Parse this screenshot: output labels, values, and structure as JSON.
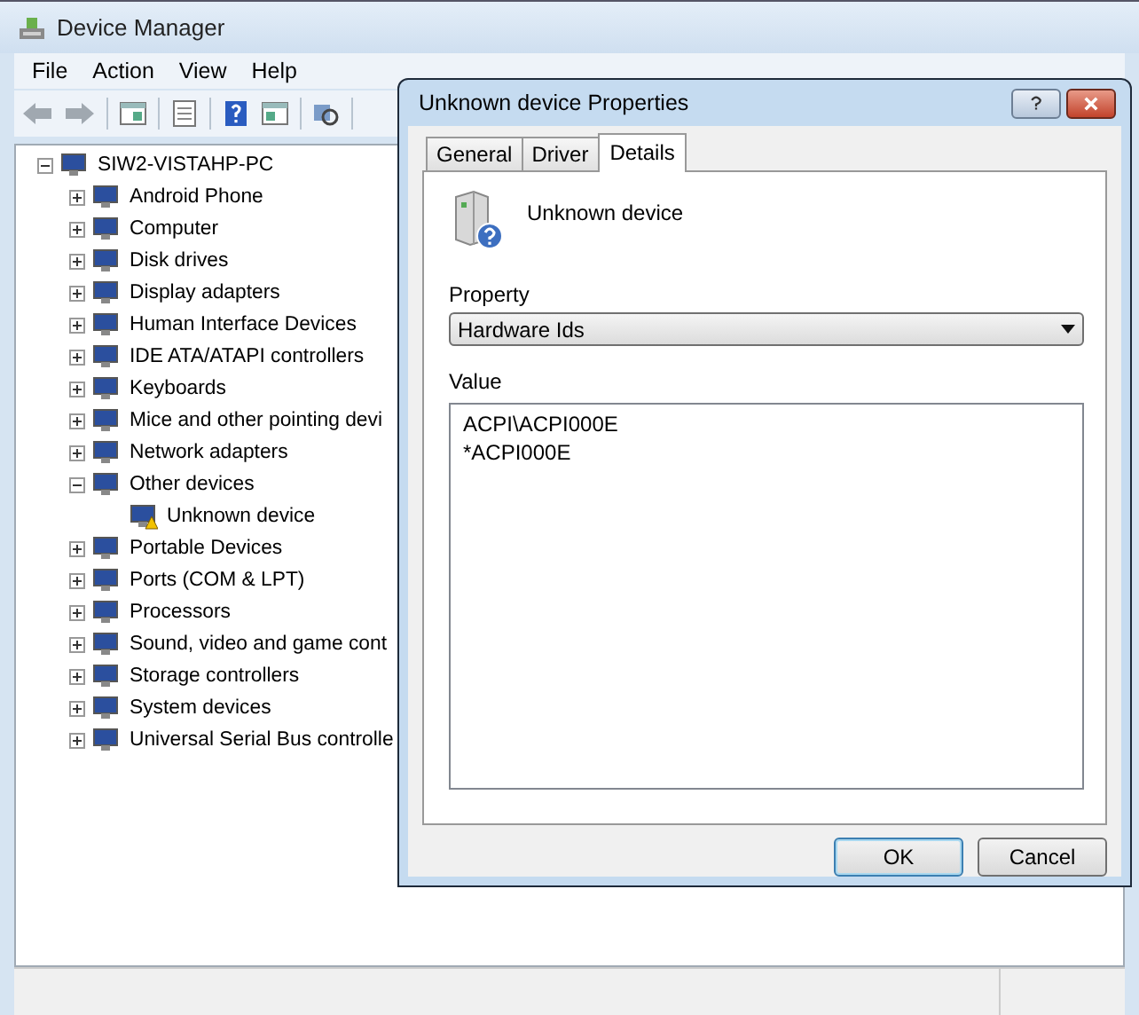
{
  "window": {
    "title": "Device Manager"
  },
  "menu": [
    "File",
    "Action",
    "View",
    "Help"
  ],
  "tree": {
    "label": "SIW2-VISTAHP-PC",
    "expanded": true,
    "children": [
      {
        "label": "Android Phone",
        "expanded": false
      },
      {
        "label": "Computer",
        "expanded": false
      },
      {
        "label": "Disk drives",
        "expanded": false
      },
      {
        "label": "Display adapters",
        "expanded": false
      },
      {
        "label": "Human Interface Devices",
        "expanded": false
      },
      {
        "label": "IDE ATA/ATAPI controllers",
        "expanded": false
      },
      {
        "label": "Keyboards",
        "expanded": false
      },
      {
        "label": "Mice and other pointing devi",
        "expanded": false
      },
      {
        "label": "Network adapters",
        "expanded": false
      },
      {
        "label": "Other devices",
        "expanded": true,
        "children": [
          {
            "label": "Unknown device",
            "warning": true
          }
        ]
      },
      {
        "label": "Portable Devices",
        "expanded": false
      },
      {
        "label": "Ports (COM & LPT)",
        "expanded": false
      },
      {
        "label": "Processors",
        "expanded": false
      },
      {
        "label": "Sound, video and game cont",
        "expanded": false
      },
      {
        "label": "Storage controllers",
        "expanded": false
      },
      {
        "label": "System devices",
        "expanded": false
      },
      {
        "label": "Universal Serial Bus controlle",
        "expanded": false
      }
    ]
  },
  "dialog": {
    "title": "Unknown device Properties",
    "tabs": [
      {
        "label": "General",
        "selected": false
      },
      {
        "label": "Driver",
        "selected": false
      },
      {
        "label": "Details",
        "selected": true
      }
    ],
    "device_name": "Unknown device",
    "property_label": "Property",
    "property_value": "Hardware Ids",
    "value_label": "Value",
    "values": [
      "ACPI\\ACPI000E",
      "*ACPI000E"
    ],
    "buttons": [
      {
        "label": "OK",
        "default": true
      },
      {
        "label": "Cancel",
        "default": false
      }
    ]
  }
}
